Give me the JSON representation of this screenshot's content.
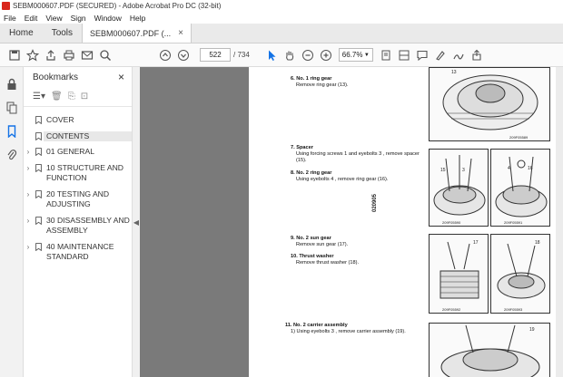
{
  "window": {
    "title": "SEBM000607.PDF (SECURED) - Adobe Acrobat Pro DC (32-bit)"
  },
  "menu": [
    "File",
    "Edit",
    "View",
    "Sign",
    "Window",
    "Help"
  ],
  "tabs": {
    "home": "Home",
    "tools": "Tools",
    "document": "SEBM000607.PDF (..."
  },
  "toolbar": {
    "current_page": "522",
    "total_pages": "/ 734",
    "zoom": "66.7%"
  },
  "bookmarks": {
    "title": "Bookmarks",
    "items": [
      {
        "label": "COVER",
        "expandable": false,
        "selected": false
      },
      {
        "label": "CONTENTS",
        "expandable": false,
        "selected": true
      },
      {
        "label": "01 GENERAL",
        "expandable": true,
        "selected": false
      },
      {
        "label": "10 STRUCTURE AND FUNCTION",
        "expandable": true,
        "selected": false
      },
      {
        "label": "20 TESTING AND ADJUSTING",
        "expandable": true,
        "selected": false
      },
      {
        "label": "30 DISASSEMBLY AND ASSEMBLY",
        "expandable": true,
        "selected": false
      },
      {
        "label": "40 MAINTENANCE STANDARD",
        "expandable": true,
        "selected": false
      }
    ]
  },
  "document": {
    "side_number": "020905",
    "steps": [
      {
        "title": "6.  No. 1 ring gear",
        "body": "Remove ring gear (13)."
      },
      {
        "title": "7.  Spacer",
        "body": "Using forcing screws  1  and eyebolts  3 , remove spacer (15)."
      },
      {
        "title": "8.  No. 2 ring gear",
        "body": "Using eyebolts  4 , remove ring gear (16)."
      },
      {
        "title": "9.  No. 2 sun gear",
        "body": "Remove sun gear (17)."
      },
      {
        "title": "10.  Thrust washer",
        "body": "Remove thrust washer (18)."
      },
      {
        "title": "11.  No. 2 carrier assembly",
        "body": "1)   Using eyebolts  3 , remove carrier assembly (19)."
      }
    ],
    "figure_captions": [
      "209F05589",
      "209F05590",
      "209F05591",
      "209F05592",
      "209F05593"
    ],
    "figure_callouts": [
      "13",
      "15",
      "3",
      "4",
      "16",
      "17",
      "18",
      "19"
    ]
  }
}
